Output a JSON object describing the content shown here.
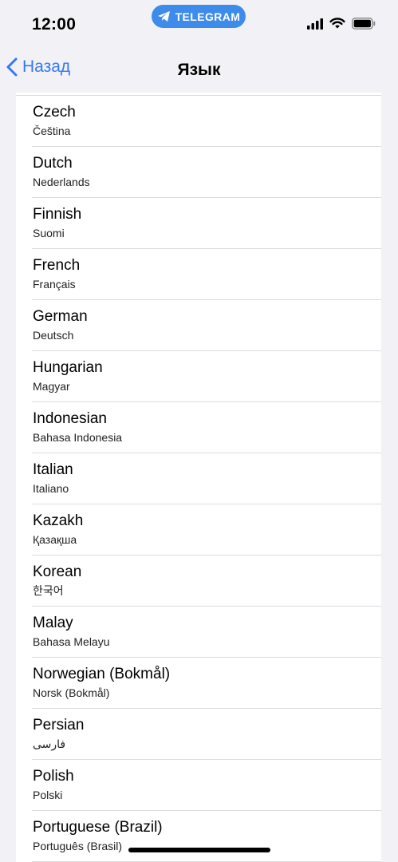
{
  "status_bar": {
    "time": "12:00",
    "app_pill": {
      "label": "TELEGRAM",
      "icon": "telegram-plane-icon",
      "color": "#3d8bea"
    },
    "icons": [
      "cellular-signal-icon",
      "wifi-icon",
      "battery-icon"
    ]
  },
  "nav": {
    "back_label": "Назад",
    "title": "Язык",
    "accent_color": "#3478f6"
  },
  "languages": [
    {
      "name": "Czech",
      "native": "Čeština"
    },
    {
      "name": "Dutch",
      "native": "Nederlands"
    },
    {
      "name": "Finnish",
      "native": "Suomi"
    },
    {
      "name": "French",
      "native": "Français"
    },
    {
      "name": "German",
      "native": "Deutsch"
    },
    {
      "name": "Hungarian",
      "native": "Magyar"
    },
    {
      "name": "Indonesian",
      "native": "Bahasa Indonesia"
    },
    {
      "name": "Italian",
      "native": "Italiano"
    },
    {
      "name": "Kazakh",
      "native": "Қазақша"
    },
    {
      "name": "Korean",
      "native": "한국어"
    },
    {
      "name": "Malay",
      "native": "Bahasa Melayu"
    },
    {
      "name": "Norwegian (Bokmål)",
      "native": "Norsk (Bokmål)"
    },
    {
      "name": "Persian",
      "native": "فارسی"
    },
    {
      "name": "Polish",
      "native": "Polski"
    },
    {
      "name": "Portuguese (Brazil)",
      "native": "Português (Brasil)"
    }
  ]
}
